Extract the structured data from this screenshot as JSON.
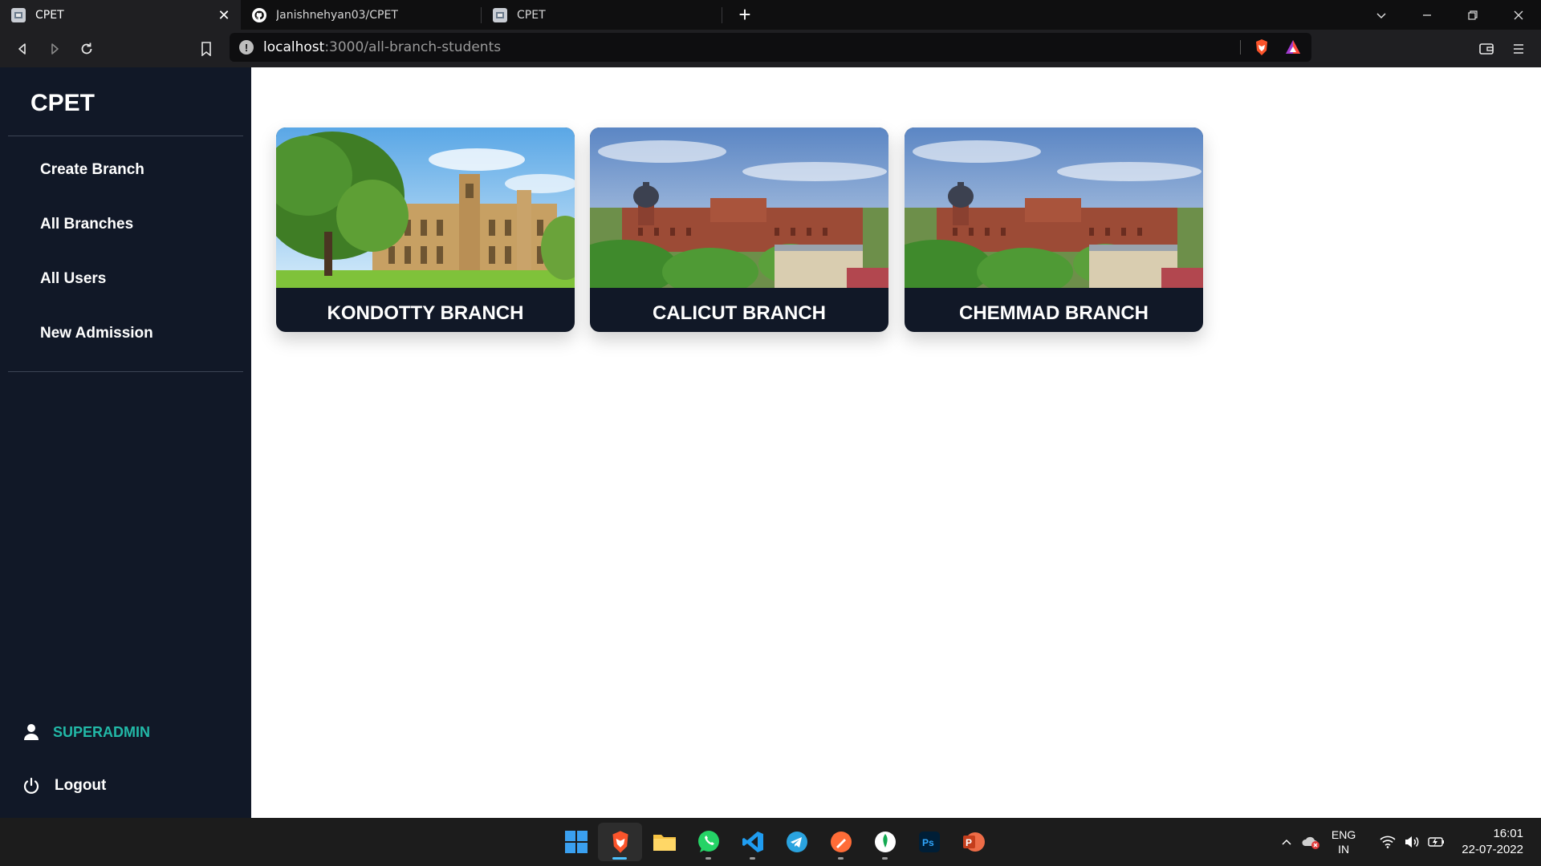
{
  "browser": {
    "tabs": [
      {
        "title": "CPET",
        "active": true
      },
      {
        "title": "Janishnehyan03/CPET",
        "active": false
      },
      {
        "title": "CPET",
        "active": false
      }
    ],
    "url_host": "localhost",
    "url_path": ":3000/all-branch-students"
  },
  "sidebar": {
    "brand": "CPET",
    "nav": [
      {
        "label": "Create Branch"
      },
      {
        "label": "All Branches"
      },
      {
        "label": "All Users"
      },
      {
        "label": "New Admission"
      }
    ],
    "user_label": "SUPERADMIN",
    "logout_label": "Logout"
  },
  "branches": [
    {
      "name": "KONDOTTY BRANCH",
      "image": "sandstone-college-building"
    },
    {
      "name": "CALICUT BRANCH",
      "image": "red-brick-university-aerial"
    },
    {
      "name": "CHEMMAD BRANCH",
      "image": "red-brick-university-aerial"
    }
  ],
  "taskbar": {
    "apps": [
      "windows-start",
      "brave",
      "file-explorer",
      "whatsapp",
      "vscode",
      "telegram",
      "postman",
      "mongodb-compass",
      "photoshop",
      "powerpoint"
    ],
    "lang_top": "ENG",
    "lang_bottom": "IN",
    "time": "16:01",
    "date": "22-07-2022"
  },
  "colors": {
    "sidebar_bg": "#111827",
    "accent_user": "#22b8a7",
    "card_title_bg": "#111827"
  }
}
